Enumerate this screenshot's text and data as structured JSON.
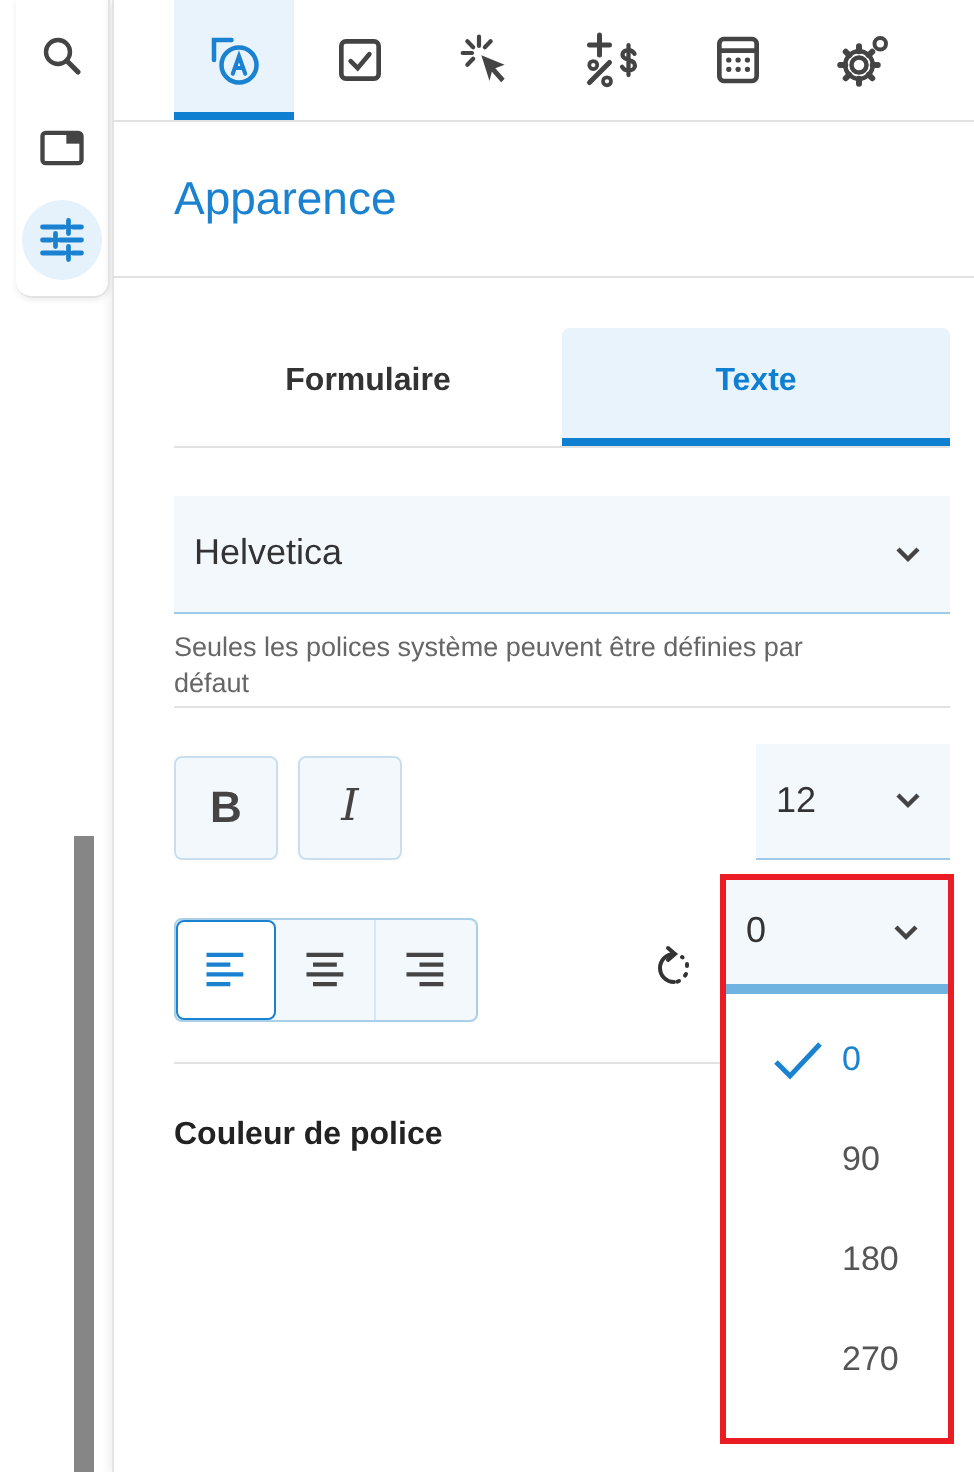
{
  "rail": {
    "items": [
      {
        "kind": "search",
        "selected": false
      },
      {
        "kind": "panel",
        "selected": false
      },
      {
        "kind": "sliders",
        "selected": true
      }
    ]
  },
  "toolbar": {
    "tabs": [
      {
        "kind": "text-style",
        "selected": true
      },
      {
        "kind": "checkbox",
        "selected": false
      },
      {
        "kind": "click",
        "selected": false
      },
      {
        "kind": "format",
        "selected": false
      },
      {
        "kind": "calculator",
        "selected": false
      },
      {
        "kind": "gears",
        "selected": false
      }
    ]
  },
  "title": "Apparence",
  "mode_tabs": [
    {
      "label": "Formulaire",
      "selected": false
    },
    {
      "label": "Texte",
      "selected": true
    }
  ],
  "font": {
    "value": "Helvetica",
    "help": "Seules les polices système peuvent être définies par défaut"
  },
  "style_buttons": [
    {
      "kind": "bold",
      "label": "B",
      "on": false
    },
    {
      "kind": "italic",
      "label": "I",
      "on": false
    }
  ],
  "size": {
    "value": "12"
  },
  "alignment": [
    {
      "kind": "left",
      "selected": true
    },
    {
      "kind": "center",
      "selected": false
    },
    {
      "kind": "right",
      "selected": false
    }
  ],
  "rotation": {
    "value": "0",
    "expanded": true,
    "highlighted": true,
    "options": [
      {
        "label": "0",
        "selected": true
      },
      {
        "label": "90",
        "selected": false
      },
      {
        "label": "180",
        "selected": false
      },
      {
        "label": "270",
        "selected": false
      }
    ]
  },
  "color_label": "Couleur de police"
}
